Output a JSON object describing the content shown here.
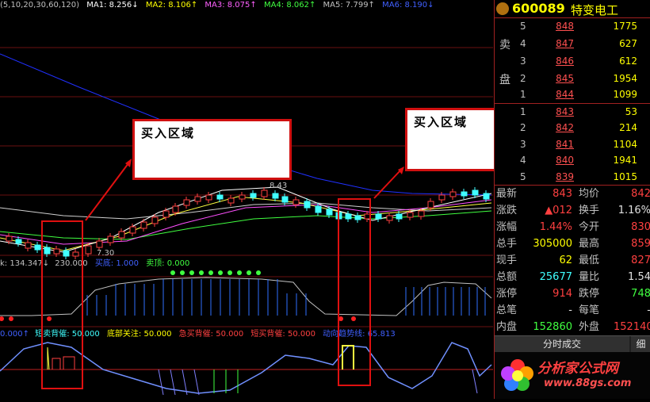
{
  "chart_header": {
    "params": "(5,10,20,30,60,120)",
    "ma1": "MA1: 8.256↓",
    "ma2": "MA2: 8.106↑",
    "ma3": "MA3: 8.075↑",
    "ma4": "MA4: 8.062↑",
    "ma5": "MA5: 7.799↑",
    "ma6": "MA6: 8.190↓"
  },
  "price_labels": {
    "high": "8.43",
    "low": "7.30"
  },
  "indicator1": {
    "val1": "k: 134.347↓",
    "val2": "230.000",
    "buy_bottom": "买底: 1.000",
    "sell_top": "卖顶: 0.000"
  },
  "indicator2": {
    "v0": "0.000↑",
    "short_sell": "短卖背催: 50.000",
    "bottom_focus": "底部关注: 50.000",
    "urgent_buy": "急买背催: 50.000",
    "short_buy": "短买背催: 50.000",
    "trend": "动向趋势线: 65.813"
  },
  "callouts": [
    {
      "label": "买入区域"
    },
    {
      "label": "买入区域"
    }
  ],
  "stock": {
    "code": "600089",
    "name": "特变电工"
  },
  "orderbook": {
    "sell_label_1": "卖",
    "sell_label_2": "盘",
    "sell": [
      {
        "i": "5",
        "price": "848",
        "vol": "1775"
      },
      {
        "i": "4",
        "price": "847",
        "vol": "627"
      },
      {
        "i": "3",
        "price": "846",
        "vol": "612"
      },
      {
        "i": "2",
        "price": "845",
        "vol": "1954"
      },
      {
        "i": "1",
        "price": "844",
        "vol": "1099"
      }
    ],
    "buy": [
      {
        "i": "1",
        "price": "843",
        "vol": "53"
      },
      {
        "i": "2",
        "price": "842",
        "vol": "214"
      },
      {
        "i": "3",
        "price": "841",
        "vol": "1104"
      },
      {
        "i": "4",
        "price": "840",
        "vol": "1941"
      },
      {
        "i": "5",
        "price": "839",
        "vol": "1015"
      }
    ]
  },
  "stats": [
    {
      "l1": "最新",
      "v1": "843",
      "c1": "red",
      "l2": "均价",
      "v2": "842",
      "c2": "red"
    },
    {
      "l1": "涨跌",
      "v1": "▲012",
      "c1": "red",
      "l2": "换手",
      "v2": "1.16%",
      "c2": "wht"
    },
    {
      "l1": "涨幅",
      "v1": "1.44%",
      "c1": "red",
      "l2": "今开",
      "v2": "830",
      "c2": "red"
    },
    {
      "l1": "总手",
      "v1": "305000",
      "c1": "yel",
      "l2": "最高",
      "v2": "859",
      "c2": "red"
    },
    {
      "l1": "现手",
      "v1": "62",
      "c1": "yel",
      "l2": "最低",
      "v2": "827",
      "c2": "red"
    },
    {
      "l1": "总额",
      "v1": "25677",
      "c1": "cyan",
      "l2": "量比",
      "v2": "1.54",
      "c2": "wht"
    },
    {
      "l1": "涨停",
      "v1": "914",
      "c1": "red",
      "l2": "跌停",
      "v2": "748",
      "c2": "grn"
    },
    {
      "l1": "总笔",
      "v1": "-",
      "c1": "wht",
      "l2": "每笔",
      "v2": "-",
      "c2": "wht"
    },
    {
      "l1": "内盘",
      "v1": "152860",
      "c1": "grn",
      "l2": "外盘",
      "v2": "152140",
      "c2": "red"
    }
  ],
  "tabs": {
    "t1": "分时成交",
    "t2": "细"
  },
  "brand": {
    "name": "分析家公式网",
    "url": "www.88gs.com"
  },
  "colors": {
    "up": "#ff4040",
    "down": "#40ffff",
    "accent": "#d01010"
  }
}
